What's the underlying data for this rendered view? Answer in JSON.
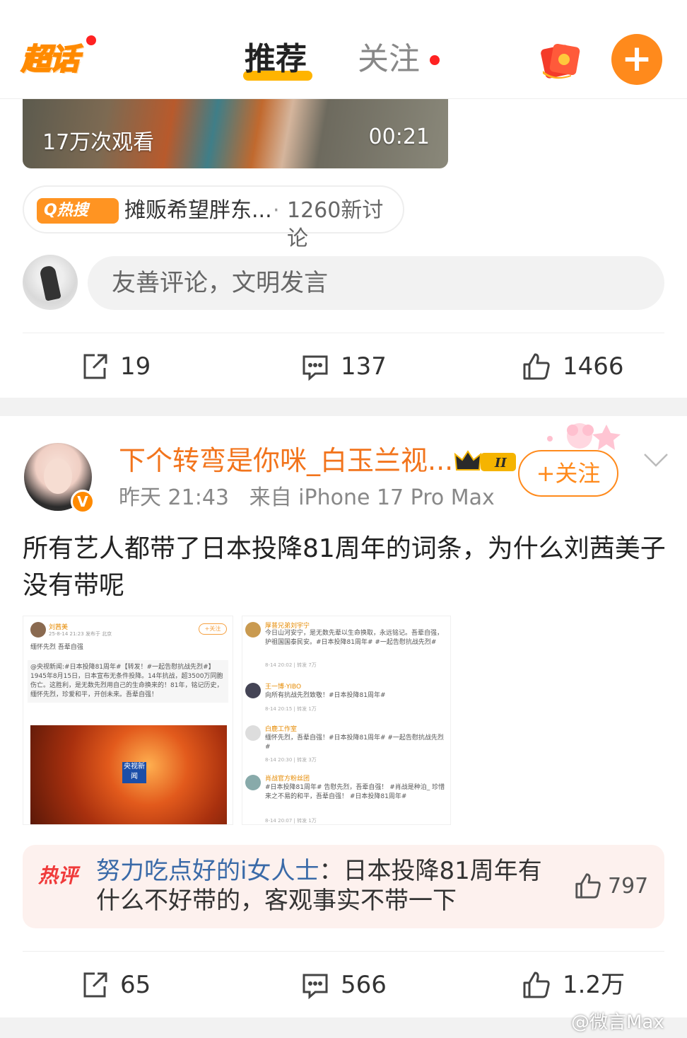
{
  "topnav": {
    "logo_text": "超话",
    "tab_recommend": "推荐",
    "tab_follow": "关注"
  },
  "video": {
    "views": "17万次观看",
    "duration": "00:21"
  },
  "hot_search": {
    "badge": "Q热搜",
    "topic": "摊贩希望胖东...",
    "separator": "·",
    "discussion_count": "1260新讨论"
  },
  "comment_box": {
    "placeholder": "友善评论，文明发言"
  },
  "post1_actions": {
    "repost": "19",
    "comment": "137",
    "like": "1466"
  },
  "post2": {
    "author": "下个转弯是你咪_白玉兰视...",
    "level_badge": "II",
    "verified_badge": "V",
    "time": "昨天 21:43",
    "source": "来自 iPhone 17 Pro Max",
    "follow_label": "+关注",
    "text": "所有艺人都带了日本投降81周年的词条，为什么刘茜美子没有带呢",
    "image_left": {
      "name": "刘茜美",
      "meta": "25-8-14 21:23  发布于 北京",
      "line1": "缅怀先烈 吾辈自强",
      "quote": "@央视新闻:#日本投降81周年#【转发！#一起告慰抗战先烈#】1945年8月15日，日本宣布无条件投降。14年抗战，超3500万同胞伤亡。这胜利，是无数先烈用自己的生命换来的！81年，铭记历史，缅怀先烈，珍爱和平，开创未来。吾辈自强！",
      "logo": "央视新闻",
      "follow": "+关注"
    },
    "image_right": [
      {
        "name": "厚普兄弟刘宇宁",
        "text": "今日山河安宁，是无数先辈以生命换取，永远铭记。吾辈自强，护祖国国泰民安。#日本投降81周年# #一起告慰抗战先烈#",
        "meta": "8-14 20:02 | 转发 7万"
      },
      {
        "name": "王一博·YIBO",
        "text": "向所有抗战先烈致敬！#日本投降81周年#",
        "meta": "8-14 20:15 | 转发 1万"
      },
      {
        "name": "白鹿工作室",
        "text": "缅怀先烈，吾辈自强！#日本投降81周年# #一起告慰抗战先烈#",
        "meta": "8-14 20:30 | 转发 3万"
      },
      {
        "name": "肖战官方粉丝团",
        "text": "#日本投降81周年# 告慰先烈，吾辈自强！ #肖战是种泊_ 珍惜来之不易的和平，吾辈自强！ #日本投降81周年#",
        "meta": "8-14 20:07 | 转发 1万"
      }
    ],
    "hot_comment": {
      "tag": "热评",
      "user": "努力吃点好的i女人士",
      "text": "：日本投降81周年有什么不好带的，客观事实不带一下",
      "likes": "797"
    },
    "actions": {
      "repost": "65",
      "comment": "566",
      "like": "1.2万"
    }
  },
  "watermark": "@微言Max",
  "colors": {
    "brand_orange": "#ff8a1c",
    "name_orange": "#f2741c",
    "hot_red": "#f03a3a",
    "link_blue": "#3a6aa8"
  }
}
